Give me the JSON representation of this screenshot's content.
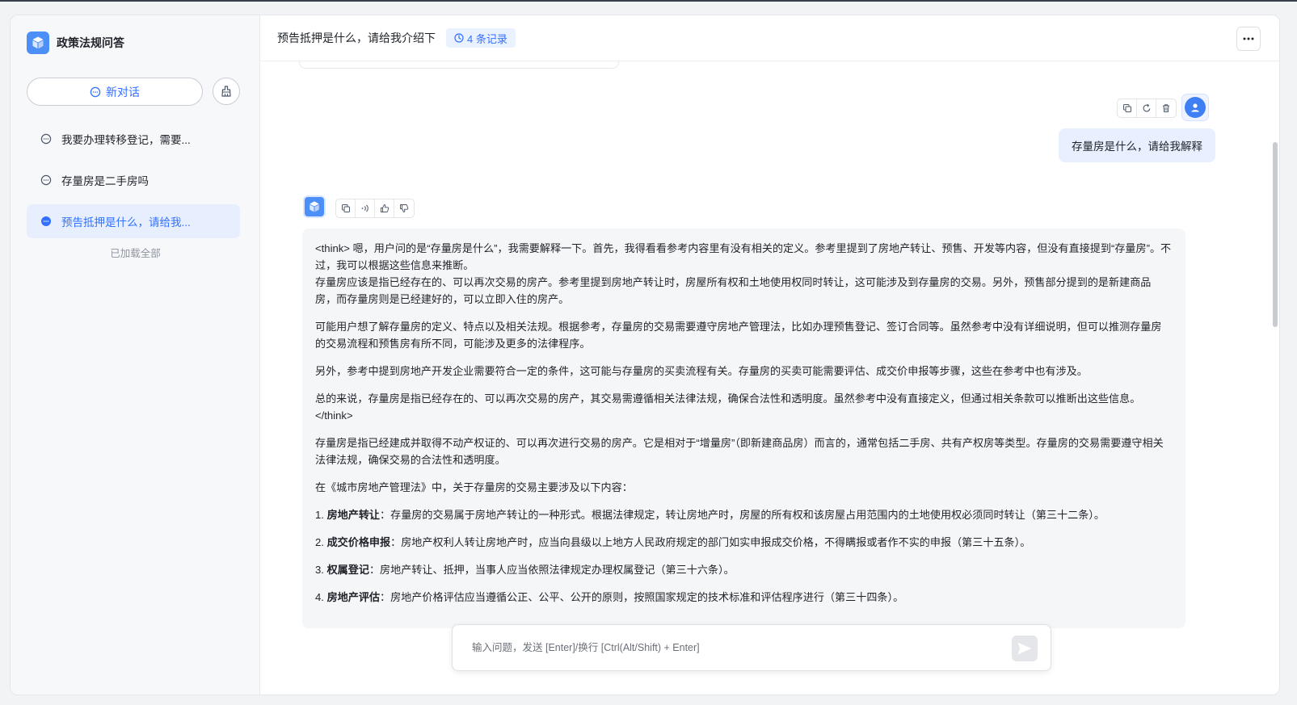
{
  "app": {
    "title": "政策法规问答",
    "logo_icon": "cube-logo-icon",
    "accent_color": "#3370ff"
  },
  "sidebar": {
    "new_chat_label": "新对话",
    "history": [
      {
        "title": "我要办理转移登记，需要...",
        "active": false
      },
      {
        "title": "存量房是二手房吗",
        "active": false
      },
      {
        "title": "预告抵押是什么，请给我...",
        "active": true
      }
    ],
    "loaded_all_text": "已加载全部"
  },
  "header": {
    "title": "预告抵押是什么，请给我介绍下",
    "record_badge": "4 条记录"
  },
  "conversation": {
    "user_message": "存量房是什么，请给我解释",
    "ai_paragraphs": [
      "<think> 嗯，用户问的是“存量房是什么”，我需要解释一下。首先，我得看看参考内容里有没有相关的定义。参考里提到了房地产转让、预售、开发等内容，但没有直接提到“存量房”。不过，我可以根据这些信息来推断。",
      "存量房应该是指已经存在的、可以再次交易的房产。参考里提到房地产转让时，房屋所有权和土地使用权同时转让，这可能涉及到存量房的交易。另外，预售部分提到的是新建商品房，而存量房则是已经建好的，可以立即入住的房产。",
      "可能用户想了解存量房的定义、特点以及相关法规。根据参考，存量房的交易需要遵守房地产管理法，比如办理预售登记、签订合同等。虽然参考中没有详细说明，但可以推测存量房的交易流程和预售房有所不同，可能涉及更多的法律程序。",
      "另外，参考中提到房地产开发企业需要符合一定的条件，这可能与存量房的买卖流程有关。存量房的买卖可能需要评估、成交价申报等步骤，这些在参考中也有涉及。",
      "总的来说，存量房是指已经存在的、可以再次交易的房产，其交易需遵循相关法律法规，确保合法性和透明度。虽然参考中没有直接定义，但通过相关条款可以推断出这些信息。",
      "</think>",
      "存量房是指已经建成并取得不动产权证的、可以再次进行交易的房产。它是相对于“增量房”（即新建商品房）而言的，通常包括二手房、共有产权房等类型。存量房的交易需要遵守相关法律法规，确保交易的合法性和透明度。",
      "在《城市房地产管理法》中，关于存量房的交易主要涉及以下内容："
    ],
    "ai_list": [
      {
        "num": "1.",
        "term": "房地产转让",
        "text": "：存量房的交易属于房地产转让的一种形式。根据法律规定，转让房地产时，房屋的所有权和该房屋占用范围内的土地使用权必须同时转让（第三十二条）。"
      },
      {
        "num": "2.",
        "term": "成交价格申报",
        "text": "：房地产权利人转让房地产时，应当向县级以上地方人民政府规定的部门如实申报成交价格，不得瞒报或者作不实的申报（第三十五条）。"
      },
      {
        "num": "3.",
        "term": "权属登记",
        "text": "：房地产转让、抵押，当事人应当依照法律规定办理权属登记（第三十六条）。"
      },
      {
        "num": "4.",
        "term": "房地产评估",
        "text": "：房地产价格评估应当遵循公正、公平、公开的原则，按照国家规定的技术标准和评估程序进行（第三十四条）。"
      }
    ]
  },
  "input": {
    "placeholder": "输入问题，发送 [Enter]/换行 [Ctrl(Alt/Shift) + Enter]",
    "value": ""
  }
}
